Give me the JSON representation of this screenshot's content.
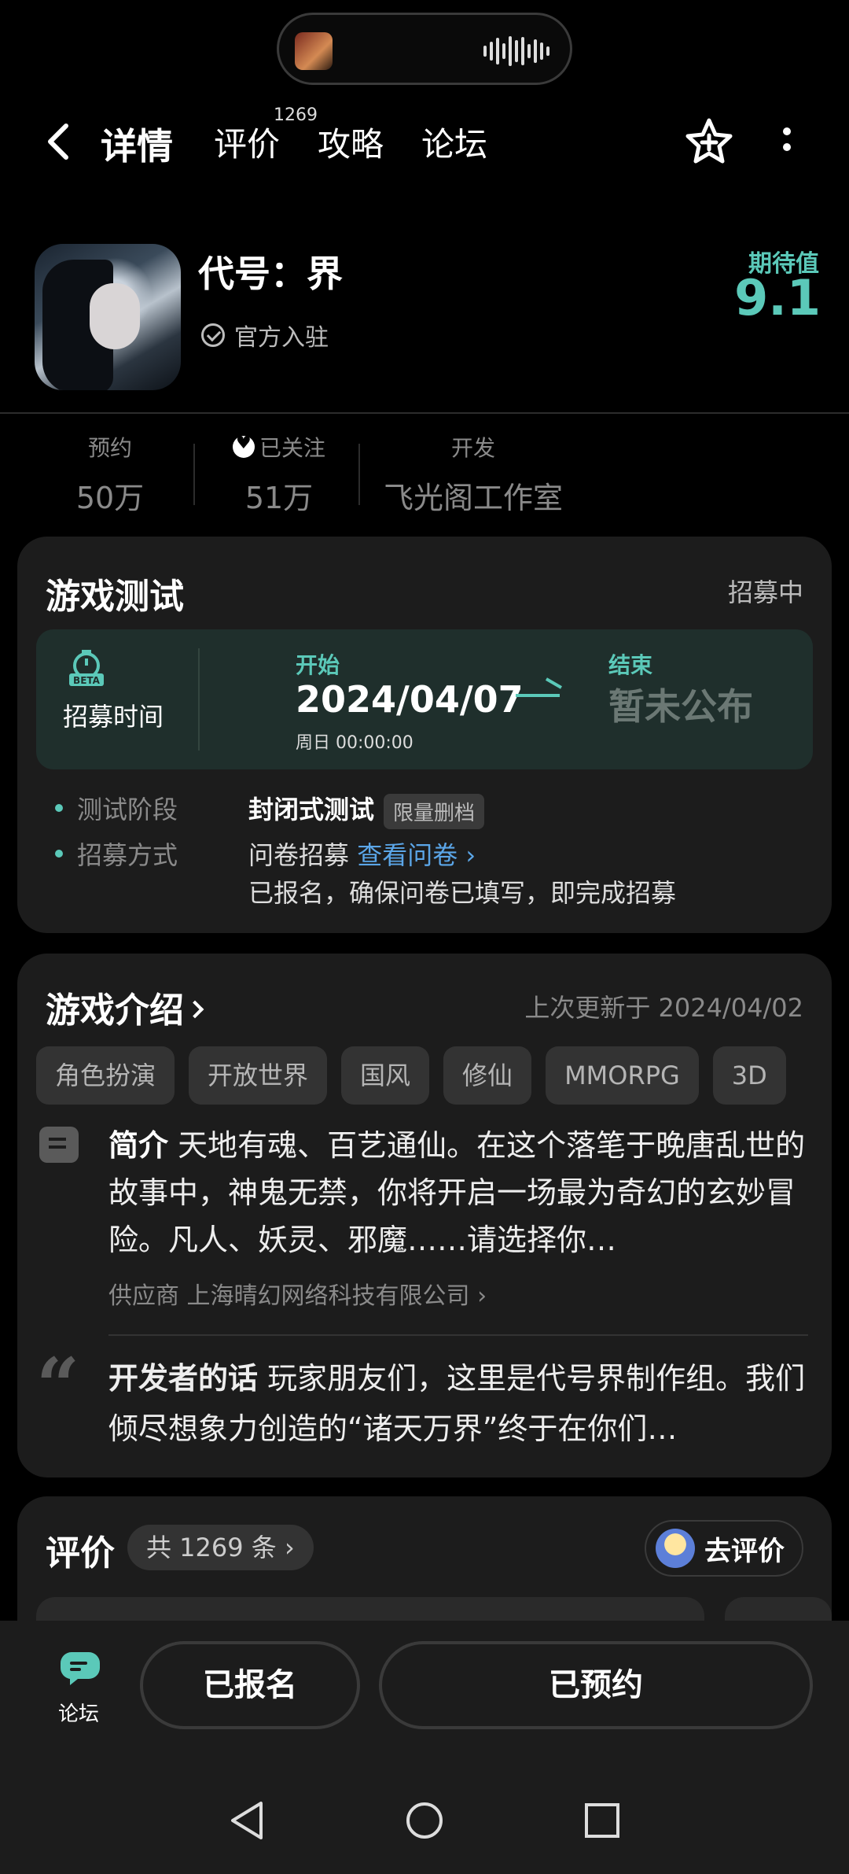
{
  "nav": {
    "tabs": [
      {
        "label": "详情"
      },
      {
        "label": "评价"
      },
      {
        "label": "攻略"
      },
      {
        "label": "论坛"
      }
    ],
    "review_badge": "1269"
  },
  "game": {
    "title": "代号：界",
    "official": "官方入驻",
    "expect_label": "期待值",
    "expect_value": "9.1"
  },
  "stats": [
    {
      "label": "预约",
      "value": "50万"
    },
    {
      "label": "已关注",
      "value": "51万"
    },
    {
      "label": "开发",
      "value": "飞光阁工作室"
    }
  ],
  "test_card": {
    "title": "游戏测试",
    "status": "招募中",
    "beta_badge": "BETA",
    "recruit_label": "招募时间",
    "start_label": "开始",
    "start_date": "2024/04/07",
    "start_time": "周日  00:00:00",
    "end_label": "结束",
    "end_value": "暂未公布",
    "rows": [
      {
        "label": "测试阶段",
        "value": "封闭式测试",
        "chip": "限量删档"
      },
      {
        "label": "招募方式",
        "value": "问卷招募",
        "link": "查看问卷",
        "note": "已报名，确保问卷已填写，即完成招募"
      }
    ]
  },
  "intro_card": {
    "title": "游戏介绍",
    "updated": "上次更新于 2024/04/02",
    "tags": [
      "角色扮演",
      "开放世界",
      "国风",
      "修仙",
      "MMORPG",
      "3D"
    ],
    "summary_label": "简介",
    "summary": "天地有魂、百艺通仙。在这个落笔于晚唐乱世的故事中，神鬼无禁，你将开启一场最为奇幻的玄妙冒险。凡人、妖灵、邪魔……请选择你…",
    "supplier_label": "供应商",
    "supplier": "上海晴幻网络科技有限公司",
    "dev_label": "开发者的话",
    "dev_words": "玩家朋友们，这里是代号界制作组。我们倾尽想象力创造的“诸天万界”终于在你们…"
  },
  "review_card": {
    "title": "评价",
    "count": "共 1269 条",
    "go_review": "去评价"
  },
  "bottom": {
    "forum_label": "论坛",
    "signed_up": "已报名",
    "reserved": "已预约"
  },
  "colors": {
    "accent": "#5bc9b9",
    "link": "#5ba6e8",
    "card_bg": "#1c1c1c",
    "page_bg": "#000000"
  }
}
